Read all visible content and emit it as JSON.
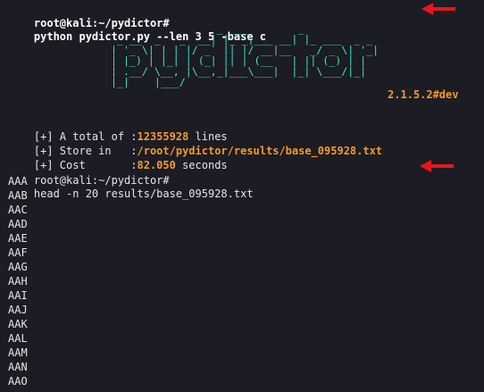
{
  "terminal": {
    "command1": {
      "prompt": "root@kali:~/pydictor#",
      "command": "python pydictor.py --len 3 5 -base c"
    },
    "banner": {
      "ascii_lines": [
        "                  _ ___        _",
        "  _ __  _   _  __| |_ _|___ __| |_ ___  _ _",
        " | '_ \\| | | |/ _` || |/ __|__   _/ _ \\| '_|",
        " | |_) | |_| | (_| || | (__   | || (_) | |",
        " | .__/ \\__, |\\__,_|___\\___|  |_| \\___/|_|",
        " |_|    |___/"
      ],
      "version": "2.1.5.2#dev"
    },
    "summary": {
      "total_label": "[+] A total of :",
      "total_value": "12355928",
      "total_suffix": " lines",
      "store_label": "[+] Store in   :",
      "store_value": "/root/pydictor/results/base_095928.txt",
      "cost_label": "[+] Cost       :",
      "cost_value": "82.050",
      "cost_suffix": " seconds"
    },
    "command2": {
      "prompt": "root@kali:~/pydictor#",
      "command": "head -n 20 results/base_095928.txt"
    },
    "output_lines": [
      "AAA",
      "AAB",
      "AAC",
      "AAD",
      "AAE",
      "AAF",
      "AAG",
      "AAH",
      "AAI",
      "AAJ",
      "AAK",
      "AAL",
      "AAM",
      "AAN",
      "AAO"
    ],
    "annotation_color": "#e8161c",
    "background_color": "#1c1c24",
    "banner_color": "#3fe0c8",
    "highlight_color": "#f39a28"
  }
}
